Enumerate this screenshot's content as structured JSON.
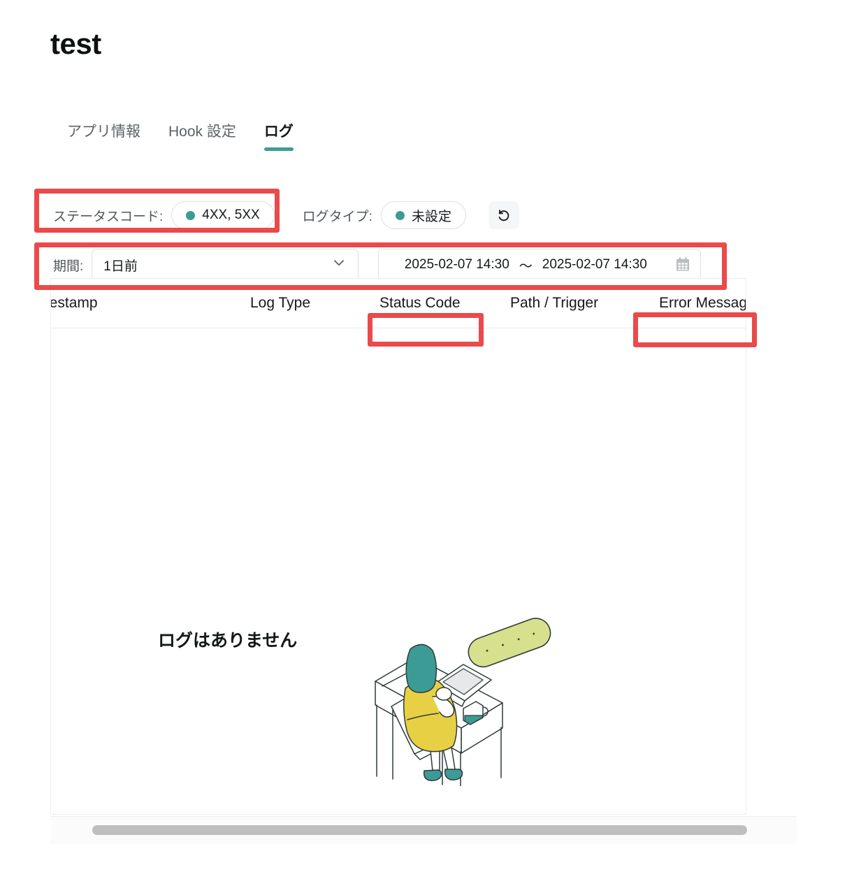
{
  "header": {
    "title": "test"
  },
  "tabs": [
    {
      "label": "アプリ情報",
      "active": false
    },
    {
      "label": "Hook 設定",
      "active": false
    },
    {
      "label": "ログ",
      "active": true
    }
  ],
  "filters": {
    "status_code": {
      "label": "ステータスコード:",
      "value": "4XX, 5XX",
      "dot_color": "#3d9b96"
    },
    "log_type": {
      "label": "ログタイプ:",
      "value": "未設定",
      "dot_color": "#3d9b96"
    },
    "reset_button": {
      "icon": "reset-arrow-icon",
      "tooltip": ""
    },
    "period": {
      "label": "期間:",
      "selected": "1日前",
      "chevron": "chevron-down-icon"
    },
    "date_range": {
      "start": "2025-02-07  14:30",
      "separator": "〜",
      "end": "2025-02-07  14:30",
      "icon": "calendar-icon"
    }
  },
  "table": {
    "columns": [
      {
        "key": "timestamp",
        "label": "nestamp"
      },
      {
        "key": "log_type",
        "label": "Log Type"
      },
      {
        "key": "status_code",
        "label": "Status Code"
      },
      {
        "key": "path_trigger",
        "label": "Path / Trigger"
      },
      {
        "key": "error_message",
        "label": "Error Message"
      }
    ],
    "rows": [],
    "empty_state": {
      "message": "ログはありません",
      "illustration": "person-at-desk-illustration"
    }
  },
  "scrollbar": {
    "orientation": "horizontal",
    "thumb_color": "#bfbfbf"
  },
  "annotations": {
    "color": "#ea4a4a",
    "boxes": [
      {
        "name": "status-code-filter-highlight"
      },
      {
        "name": "period-row-highlight"
      },
      {
        "name": "status-code-column-highlight"
      },
      {
        "name": "error-message-column-highlight"
      }
    ]
  },
  "colors": {
    "accent_teal": "#3d9b96",
    "annotation_red": "#ea4a4a",
    "illustration_yellow": "#e8d044",
    "illustration_green": "#d6e08a",
    "text_primary": "#15191b",
    "text_muted": "#5c6366"
  }
}
